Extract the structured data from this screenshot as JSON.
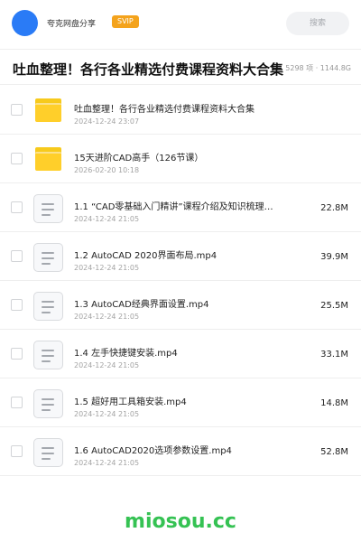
{
  "header": {
    "share_label": "夸克网盘分享",
    "badge": "SVIP",
    "search_placeholder": "搜索"
  },
  "title_row": {
    "title": "吐血整理！各行各业精选付费课程资料大合集",
    "stats": "5298 项 · 1144.8G"
  },
  "files": [
    {
      "type": "folder",
      "name": "吐血整理！各行各业精选付费课程资料大合集",
      "date": "2024-12-24 23:07",
      "size": ""
    },
    {
      "type": "folder",
      "name": "15天进阶CAD高手（126节课）",
      "date": "2026-02-20 10:18",
      "size": ""
    },
    {
      "type": "file",
      "name": "1.1 “CAD零基础入门精讲”课程介绍及知识梳理…",
      "date": "2024-12-24 21:05",
      "size": "22.8M"
    },
    {
      "type": "file",
      "name": "1.2 AutoCAD 2020界面布局.mp4",
      "date": "2024-12-24 21:05",
      "size": "39.9M"
    },
    {
      "type": "file",
      "name": "1.3 AutoCAD经典界面设置.mp4",
      "date": "2024-12-24 21:05",
      "size": "25.5M"
    },
    {
      "type": "file",
      "name": "1.4 左手快捷键安装.mp4",
      "date": "2024-12-24 21:05",
      "size": "33.1M"
    },
    {
      "type": "file",
      "name": "1.5 超好用工具箱安装.mp4",
      "date": "2024-12-24 21:05",
      "size": "14.8M"
    },
    {
      "type": "file",
      "name": "1.6 AutoCAD2020选项参数设置.mp4",
      "date": "2024-12-24 21:05",
      "size": "52.8M"
    }
  ],
  "watermark": "miosou.cc",
  "colors": {
    "avatar": "#2a7bf6",
    "svip": "#f4a31c",
    "folder": "#ffcf2a",
    "watermark": "#35c253"
  }
}
